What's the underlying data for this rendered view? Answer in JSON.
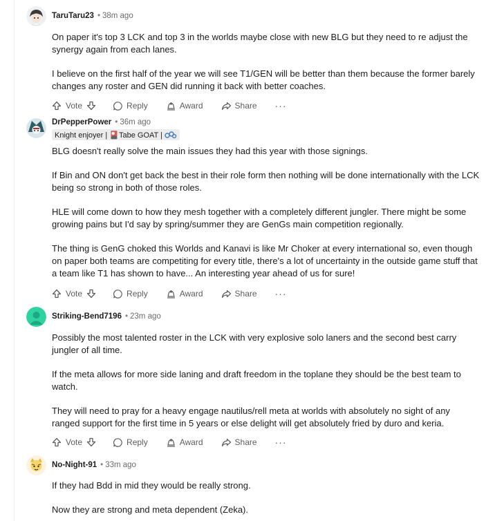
{
  "comments": [
    {
      "author": "TaruTaru23",
      "time": "38m ago",
      "paragraphs": [
        "On paper it's top 3 LCK and top 3 in the worlds maybe close with new BLG but they need to re adjust the synergy again from each lanes.",
        "I believe on the first half of the year we will see T1/GEN will be better than them because the former barely changes any roster and GEN did running it back with better coaches."
      ],
      "avatar_color": "#f2f2f2"
    },
    {
      "author": "DrPepperPower",
      "time": "36m ago",
      "flair": "Knight enjoyer | 🎴Tabe GOAT |",
      "paragraphs": [
        "BLG doesn't really solve the main issues they had this year with those signings.",
        "If Bin and ON don't get back the best in their role form then nothing will be done internationally with the LCK being so strong in both of those roles.",
        "HLE will come down to how they mesh together with a completely different jungler. There might be some growing pains but I'd say by spring/summer they are GenGs main competition regionally.",
        "The thing is GenG choked this Worlds and Kanavi is like Mr Choker at every international so, even though on paper both teams are competiting for every title, there's a lot of uncertainty in the outside game stuff that a team like T1 has shown to have... An interesting year ahead of us for sure!"
      ],
      "avatar_color": "#2e5a66"
    },
    {
      "author": "Striking-Bend7196",
      "time": "23m ago",
      "paragraphs": [
        "Possibly the most talented roster in the LCK with very explosive solo laners and the second best carry jungler of all time.",
        "If the meta allows for more side laning and draft freedom in the toplane they should be the best team to watch.",
        "They will need to pray for a heavy engage nautilus/rell meta at worlds with absolutely no sight of any ranged support for the first time in 5 years or else delight will get absolutely fried by duro and keria."
      ],
      "avatar_color": "#2ed3a0"
    },
    {
      "author": "No-Night-91",
      "time": "33m ago",
      "paragraphs": [
        "If they had Bdd in mid they would be really strong.",
        "Now they are strong and meta dependent (Zeka)."
      ],
      "avatar_color": "#f5d56a"
    }
  ],
  "actions": {
    "vote": "Vote",
    "reply": "Reply",
    "award": "Award",
    "share": "Share",
    "more": "···"
  }
}
